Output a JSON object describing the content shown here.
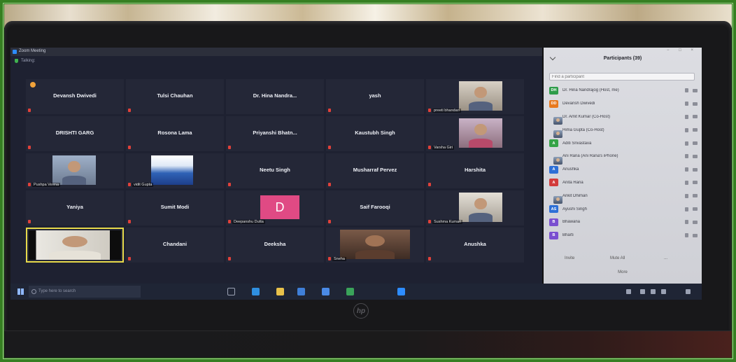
{
  "window": {
    "title": "Zoom Meeting",
    "talking": "Talking:"
  },
  "gallery": {
    "tiles": [
      {
        "kind": "name",
        "name": "Devansh Dwivedi",
        "muted": true,
        "reaction": true
      },
      {
        "kind": "name",
        "name": "Tulsi Chauhan",
        "muted": true
      },
      {
        "kind": "name",
        "name": "Dr. Hina Nandra...",
        "muted": false
      },
      {
        "kind": "name",
        "name": "yash",
        "muted": true
      },
      {
        "kind": "video",
        "name": "preeti bhandari",
        "muted": true
      },
      {
        "kind": "name",
        "name": "DRISHTI GARG",
        "muted": true
      },
      {
        "kind": "name",
        "name": "Rosona Lama",
        "muted": true
      },
      {
        "kind": "name",
        "name": "Priyanshi Bhatn...",
        "muted": true
      },
      {
        "kind": "name",
        "name": "Kaustubh Singh",
        "muted": true
      },
      {
        "kind": "video",
        "name": "Varsha Giri",
        "muted": true
      },
      {
        "kind": "video",
        "name": "Pushpa Verma",
        "muted": true
      },
      {
        "kind": "image",
        "name": "vidit Gupta",
        "muted": true
      },
      {
        "kind": "name",
        "name": "Neetu Singh",
        "muted": true
      },
      {
        "kind": "name",
        "name": "Musharraf Pervez",
        "muted": true
      },
      {
        "kind": "name",
        "name": "Harshita",
        "muted": true
      },
      {
        "kind": "name",
        "name": "Yaniya",
        "muted": true
      },
      {
        "kind": "name",
        "name": "Sumit Modi",
        "muted": true
      },
      {
        "kind": "avatar",
        "name": "Deepanshu Dutta",
        "avatar_letter": "D",
        "muted": true
      },
      {
        "kind": "name",
        "name": "Saif Farooqi",
        "muted": true
      },
      {
        "kind": "video",
        "name": "Sushma Kumari",
        "muted": true
      },
      {
        "kind": "video",
        "active": true,
        "muted": false
      },
      {
        "kind": "name",
        "name": "Chandani",
        "muted": true
      },
      {
        "kind": "name",
        "name": "Deeksha",
        "muted": true
      },
      {
        "kind": "video",
        "name": "Sneha",
        "muted": true
      },
      {
        "kind": "name",
        "name": "Anushka",
        "muted": true
      }
    ]
  },
  "participants": {
    "title": "Participants (39)",
    "window_controls": "− □ ×",
    "search_placeholder": "Find a participant",
    "items": [
      {
        "initials": "DH",
        "avatar_color": "#2e9c4a",
        "name": "Dr. Hina Nandrajog (Host, me)"
      },
      {
        "initials": "DD",
        "avatar_color": "#e8791d",
        "name": "Devansh Dwivedi"
      },
      {
        "avatar_icon": "photo-avatar-icon",
        "name": "Dr. Amit Kumar (Co-Host)"
      },
      {
        "avatar_icon": "logo-avatar-icon",
        "name": "Hima Gupta (Co-Host)"
      },
      {
        "initials": "A",
        "avatar_color": "#35a346",
        "name": "Aditi Srivastava"
      },
      {
        "avatar_icon": "photo-avatar-icon",
        "name": "Ani Rana (Ani Rana's iPhone)"
      },
      {
        "initials": "A",
        "avatar_color": "#2d6fd6",
        "name": "Anushka"
      },
      {
        "initials": "A",
        "avatar_color": "#d23b3b",
        "name": "Anita Rana"
      },
      {
        "avatar_icon": "photo-avatar-icon",
        "name": "Ankit Dhiman"
      },
      {
        "initials": "AS",
        "avatar_color": "#2d6fd6",
        "name": "Ayushi Singh"
      },
      {
        "initials": "B",
        "avatar_color": "#7a4fd0",
        "name": "Bhawana"
      },
      {
        "initials": "B",
        "avatar_color": "#7a4fd0",
        "name": "Bharti"
      }
    ],
    "buttons": {
      "invite": "Invite",
      "mute_all": "Mute All",
      "more_options": "...",
      "more": "More"
    }
  },
  "taskbar": {
    "search_placeholder": "Type here to search",
    "pinned_icons": [
      "task-view-icon",
      "edge-icon",
      "file-explorer-icon",
      "store-icon",
      "mail-icon",
      "chrome-icon",
      "zoom-icon"
    ],
    "pinned_colors": [
      "#9aa1b3",
      "#2f8fe0",
      "#e8c14a",
      "#3f7fd8",
      "#4a8ae6",
      "#3aa35a",
      "#2d8cff"
    ],
    "tray_icons": [
      "chevron-up-icon",
      "network-icon",
      "volume-icon",
      "battery-icon",
      "notification-icon"
    ]
  },
  "laptop": {
    "brand": "hp"
  },
  "colors": {
    "frame_green": "#367f22",
    "gallery_bg": "#1e2131",
    "tile_bg": "#242737",
    "panel_bg": "#d3d4da",
    "active_speaker": "#e6d94a",
    "muted_red": "#e0413a",
    "avatar_pink": "#e04a84"
  }
}
